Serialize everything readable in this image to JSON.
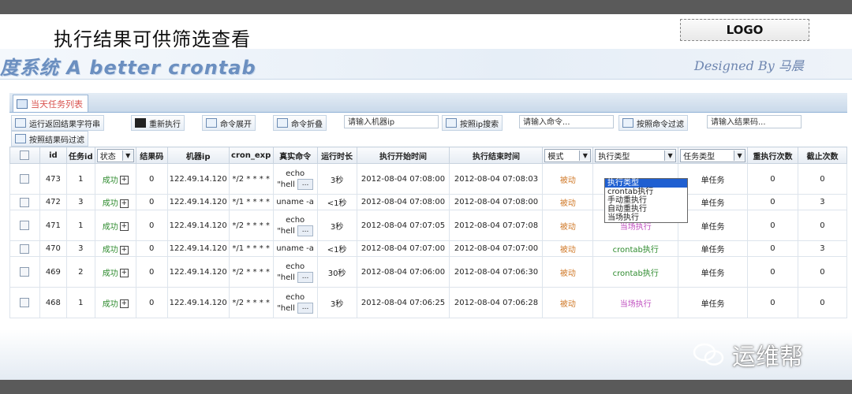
{
  "slide": {
    "title": "执行结果可供筛选查看",
    "logo": "LOGO",
    "banner_left": "度系统  A better crontab",
    "banner_right": "Designed By 马晨",
    "watermark": "运维帮"
  },
  "tab": {
    "label": "当天任务列表"
  },
  "toolbar": {
    "btn_runresult": "运行返回结果字符串",
    "btn_rerun": "重新执行",
    "btn_expand": "命令展开",
    "btn_fold": "命令折叠",
    "input_ip_placeholder": "请输入机器ip",
    "btn_search_ip": "按照ip搜索",
    "input_cmd_placeholder": "请输入命令...",
    "btn_filter_cmd": "按照命令过滤",
    "input_result_placeholder": "请输入结果码...",
    "btn_filter_result": "按照结果码过滤"
  },
  "columns": {
    "id": "id",
    "task_id": "任务id",
    "status": "状态",
    "result_code": "结果码",
    "ip": "机器ip",
    "cron": "cron_exp",
    "cmd": "真实命令",
    "duration": "运行时长",
    "start": "执行开始时间",
    "end": "执行结束时间",
    "mode": "模式",
    "exec_type": "执行类型",
    "task_type": "任务类型",
    "retry": "重执行次数",
    "cutoff": "截止次数"
  },
  "dropdown_options": [
    "执行类型",
    "crontab执行",
    "手动重执行",
    "自动重执行",
    "当场执行"
  ],
  "rows": [
    {
      "id": "473",
      "task": "1",
      "status": "成功",
      "code": "0",
      "ip": "122.49.14.120",
      "cron": "*/2 * * * *",
      "cmd1": "echo",
      "cmd2": "\"hell",
      "dur": "3秒",
      "start": "2012-08-04 07:08:00",
      "end": "2012-08-04 07:08:03",
      "mode": "被动",
      "etype": "",
      "ttype": "单任务",
      "retry": "0",
      "cut": "0"
    },
    {
      "id": "472",
      "task": "3",
      "status": "成功",
      "code": "0",
      "ip": "122.49.14.120",
      "cron": "*/1 * * * *",
      "cmd1": "uname -a",
      "cmd2": "",
      "dur": "<1秒",
      "start": "2012-08-04 07:08:00",
      "end": "2012-08-04 07:08:00",
      "mode": "被动",
      "etype": "",
      "ttype": "单任务",
      "retry": "0",
      "cut": "3"
    },
    {
      "id": "471",
      "task": "1",
      "status": "成功",
      "code": "0",
      "ip": "122.49.14.120",
      "cron": "*/2 * * * *",
      "cmd1": "echo",
      "cmd2": "\"hell",
      "dur": "3秒",
      "start": "2012-08-04 07:07:05",
      "end": "2012-08-04 07:07:08",
      "mode": "被动",
      "etype": "当场执行",
      "ttype": "单任务",
      "retry": "0",
      "cut": "0"
    },
    {
      "id": "470",
      "task": "3",
      "status": "成功",
      "code": "0",
      "ip": "122.49.14.120",
      "cron": "*/1 * * * *",
      "cmd1": "uname -a",
      "cmd2": "",
      "dur": "<1秒",
      "start": "2012-08-04 07:07:00",
      "end": "2012-08-04 07:07:00",
      "mode": "被动",
      "etype": "crontab执行",
      "ttype": "单任务",
      "retry": "0",
      "cut": "3"
    },
    {
      "id": "469",
      "task": "2",
      "status": "成功",
      "code": "0",
      "ip": "122.49.14.120",
      "cron": "*/2 * * * *",
      "cmd1": "echo",
      "cmd2": "\"hell",
      "dur": "30秒",
      "start": "2012-08-04 07:06:00",
      "end": "2012-08-04 07:06:30",
      "mode": "被动",
      "etype": "crontab执行",
      "ttype": "单任务",
      "retry": "0",
      "cut": "0"
    },
    {
      "id": "468",
      "task": "1",
      "status": "成功",
      "code": "0",
      "ip": "122.49.14.120",
      "cron": "*/2 * * * *",
      "cmd1": "echo",
      "cmd2": "\"hell",
      "dur": "3秒",
      "start": "2012-08-04 07:06:25",
      "end": "2012-08-04 07:06:28",
      "mode": "被动",
      "etype": "当场执行",
      "ttype": "单任务",
      "retry": "0",
      "cut": "0"
    }
  ],
  "colors": {
    "success": "#2e8b2e",
    "mode": "#d07a2a",
    "exec_pink": "#c050c0",
    "tab_text": "#d9534f",
    "selected": "#1f5fd1"
  }
}
